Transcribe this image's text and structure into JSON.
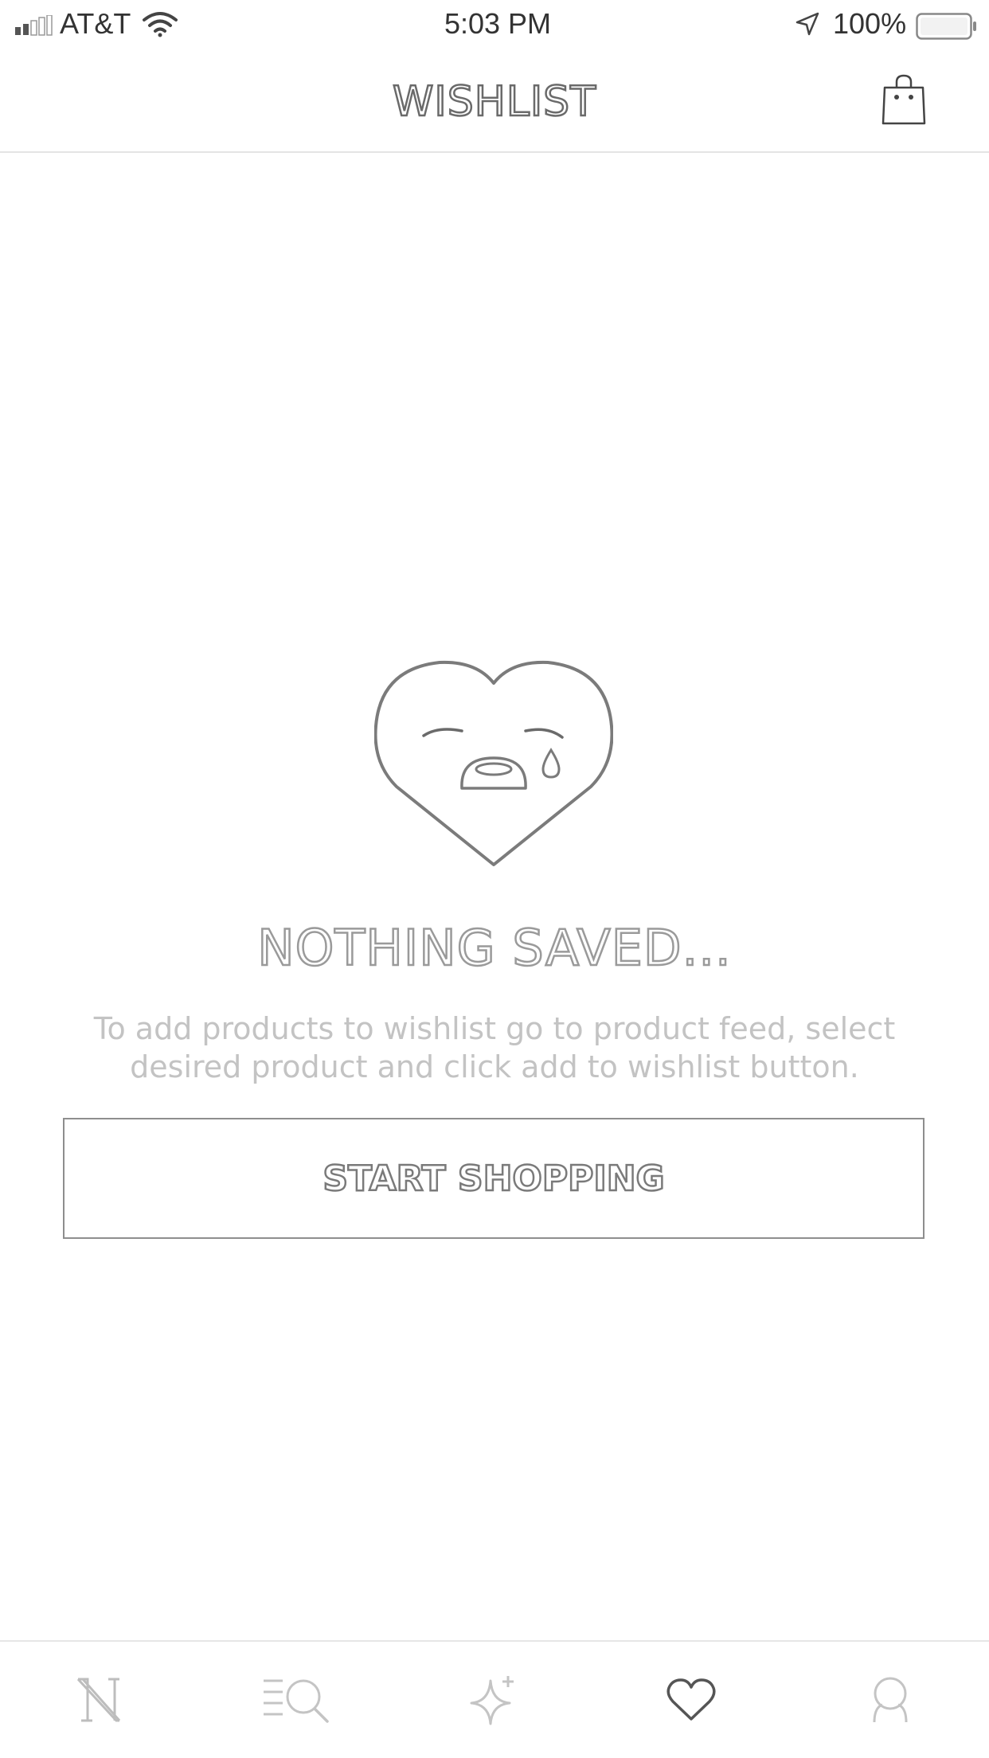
{
  "status_bar": {
    "carrier": "AT&T",
    "time": "5:03 PM",
    "battery": "100%"
  },
  "header": {
    "title": "WISHLIST",
    "cart_icon": "shopping-bag-icon"
  },
  "empty_state": {
    "illustration": "sad-heart-icon",
    "title": "NOTHING SAVED...",
    "description": "To add products to wishlist go to product feed, select desired product and click add to wishlist button.",
    "button_label": "START SHOPPING"
  },
  "tab_bar": {
    "items": [
      {
        "icon": "home-logo-icon",
        "active": false
      },
      {
        "icon": "catalog-search-icon",
        "active": false
      },
      {
        "icon": "sparkle-icon",
        "active": false
      },
      {
        "icon": "heart-icon",
        "active": true
      },
      {
        "icon": "profile-icon",
        "active": false
      }
    ]
  },
  "colors": {
    "text_dark": "#333333",
    "outline": "#6a6a6a",
    "muted": "#c3c3c3",
    "divider": "#e4e4e4"
  }
}
